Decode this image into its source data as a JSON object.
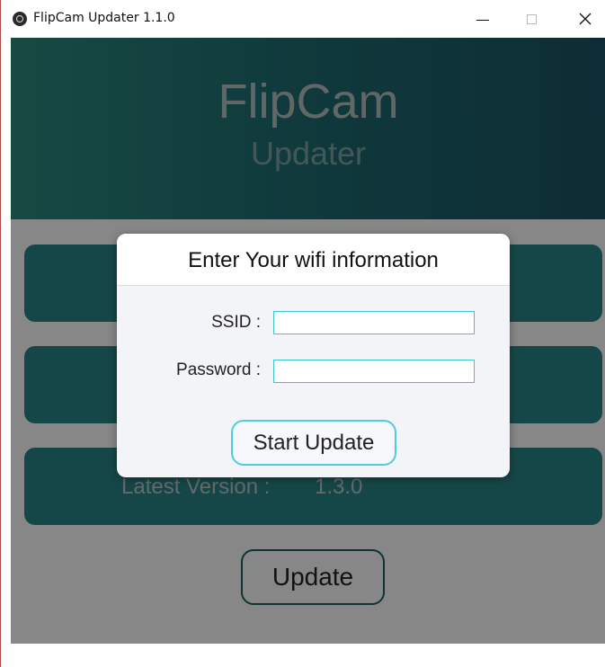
{
  "window": {
    "title": "FlipCam Updater 1.1.0",
    "minimize_glyph": "",
    "close_glyph": "✕"
  },
  "header": {
    "title": "FlipCam",
    "subtitle": "Updater"
  },
  "panels": [
    {
      "label": "",
      "value": ""
    },
    {
      "label": "",
      "value": ""
    },
    {
      "label": "Latest Version :",
      "value": "1.3.0"
    }
  ],
  "update_button": {
    "label": "Update"
  },
  "modal": {
    "title": "Enter Your wifi information",
    "ssid_label": "SSID :",
    "ssid_value": "",
    "password_label": "Password :",
    "password_value": "",
    "start_button": "Start Update"
  },
  "colors": {
    "header_gradient_start": "#2d8c7f",
    "header_gradient_end": "#1a5565",
    "panel": "#2a8688",
    "input_border": "#3cc3cf",
    "start_button_border": "#4ccfdd"
  }
}
